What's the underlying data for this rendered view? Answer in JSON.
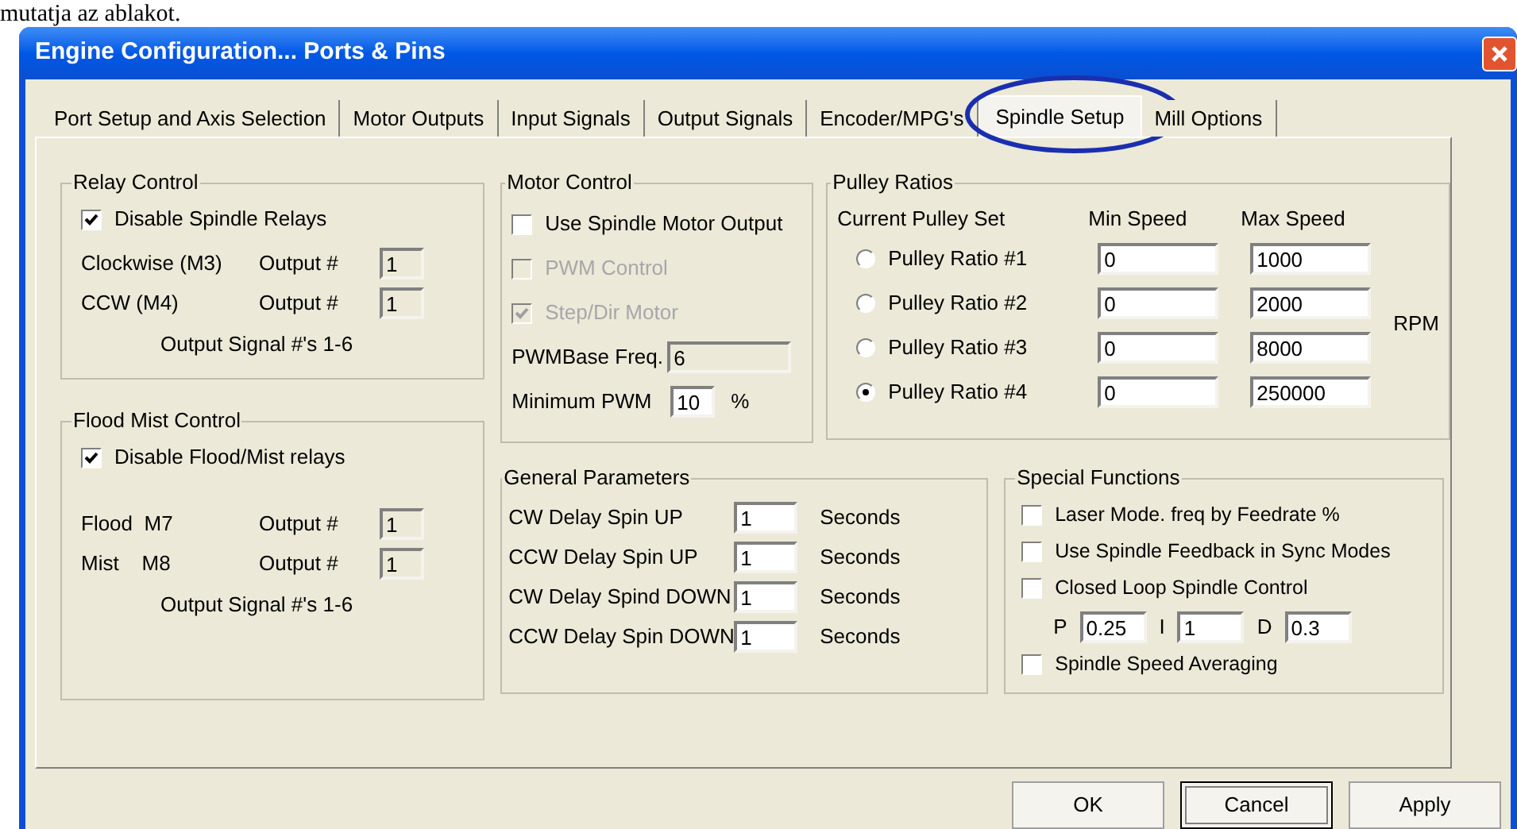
{
  "caption": "mutatja az ablakot.",
  "window": {
    "title": "Engine Configuration... Ports & Pins"
  },
  "tabs": [
    {
      "label": "Port Setup and Axis Selection",
      "selected": false
    },
    {
      "label": "Motor Outputs",
      "selected": false
    },
    {
      "label": "Input Signals",
      "selected": false
    },
    {
      "label": "Output Signals",
      "selected": false
    },
    {
      "label": "Encoder/MPG's",
      "selected": false
    },
    {
      "label": "Spindle Setup",
      "selected": true
    },
    {
      "label": "Mill Options",
      "selected": false
    }
  ],
  "relay_control": {
    "title": "Relay Control",
    "checkbox": {
      "label": "Disable Spindle Relays",
      "checked": true
    },
    "rows": [
      {
        "label": "Clockwise (M3)",
        "output_label": "Output #",
        "value": "1"
      },
      {
        "label": "CCW (M4)",
        "output_label": "Output #",
        "value": "1"
      }
    ],
    "note": "Output Signal #'s 1-6"
  },
  "flood_mist_control": {
    "title": "Flood Mist Control",
    "checkbox": {
      "label": "Disable Flood/Mist relays",
      "checked": true
    },
    "rows": [
      {
        "label": "Flood  M7",
        "output_label": "Output #",
        "value": "1"
      },
      {
        "label": "Mist    M8",
        "output_label": "Output #",
        "value": "1"
      }
    ],
    "note": "Output Signal #'s 1-6"
  },
  "motor_control": {
    "title": "Motor Control",
    "checkboxes": [
      {
        "label": "Use Spindle Motor Output",
        "checked": false,
        "disabled": false
      },
      {
        "label": "PWM Control",
        "checked": false,
        "disabled": true
      },
      {
        "label": "Step/Dir Motor",
        "checked": true,
        "disabled": true
      }
    ],
    "fields": [
      {
        "label": "PWMBase Freq.",
        "value": "6",
        "disabled": true
      },
      {
        "label": "Minimum PWM",
        "value": "10",
        "unit": "%",
        "disabled": false
      }
    ]
  },
  "pulley_ratios": {
    "title": "Pulley Ratios",
    "columns": [
      "Current Pulley Set",
      "Min Speed",
      "Max Speed"
    ],
    "rows": [
      {
        "label": "Pulley Ratio #1",
        "selected": false,
        "min": "0",
        "max": "1000"
      },
      {
        "label": "Pulley Ratio #2",
        "selected": false,
        "min": "0",
        "max": "2000"
      },
      {
        "label": "Pulley Ratio #3",
        "selected": false,
        "min": "0",
        "max": "8000"
      },
      {
        "label": "Pulley Ratio #4",
        "selected": true,
        "min": "0",
        "max": "250000"
      }
    ],
    "unit": "RPM"
  },
  "general_parameters": {
    "title": "General Parameters",
    "rows": [
      {
        "label": "CW Delay Spin UP",
        "value": "1",
        "unit": "Seconds"
      },
      {
        "label": "CCW Delay Spin UP",
        "value": "1",
        "unit": "Seconds"
      },
      {
        "label": "CW Delay Spind DOWN",
        "value": "1",
        "unit": "Seconds"
      },
      {
        "label": "CCW Delay Spin DOWN",
        "value": "1",
        "unit": "Seconds"
      }
    ]
  },
  "special_functions": {
    "title": "Special Functions",
    "items": [
      {
        "kind": "checkbox",
        "label": "Laser Mode. freq by Feedrate %",
        "checked": false
      },
      {
        "kind": "checkbox",
        "label": "Use Spindle Feedback in Sync Modes",
        "checked": false
      },
      {
        "kind": "checkbox",
        "label": "Closed Loop Spindle Control",
        "checked": false
      },
      {
        "kind": "pid",
        "fields": [
          {
            "label": "P",
            "value": "0.25"
          },
          {
            "label": "I",
            "value": "1"
          },
          {
            "label": "D",
            "value": "0.3"
          }
        ]
      },
      {
        "kind": "checkbox",
        "label": "Spindle Speed Averaging",
        "checked": false
      }
    ]
  },
  "buttons": [
    {
      "label": "OK",
      "focused": false
    },
    {
      "label": "Cancel",
      "focused": true
    },
    {
      "label": "Apply",
      "focused": false
    }
  ]
}
